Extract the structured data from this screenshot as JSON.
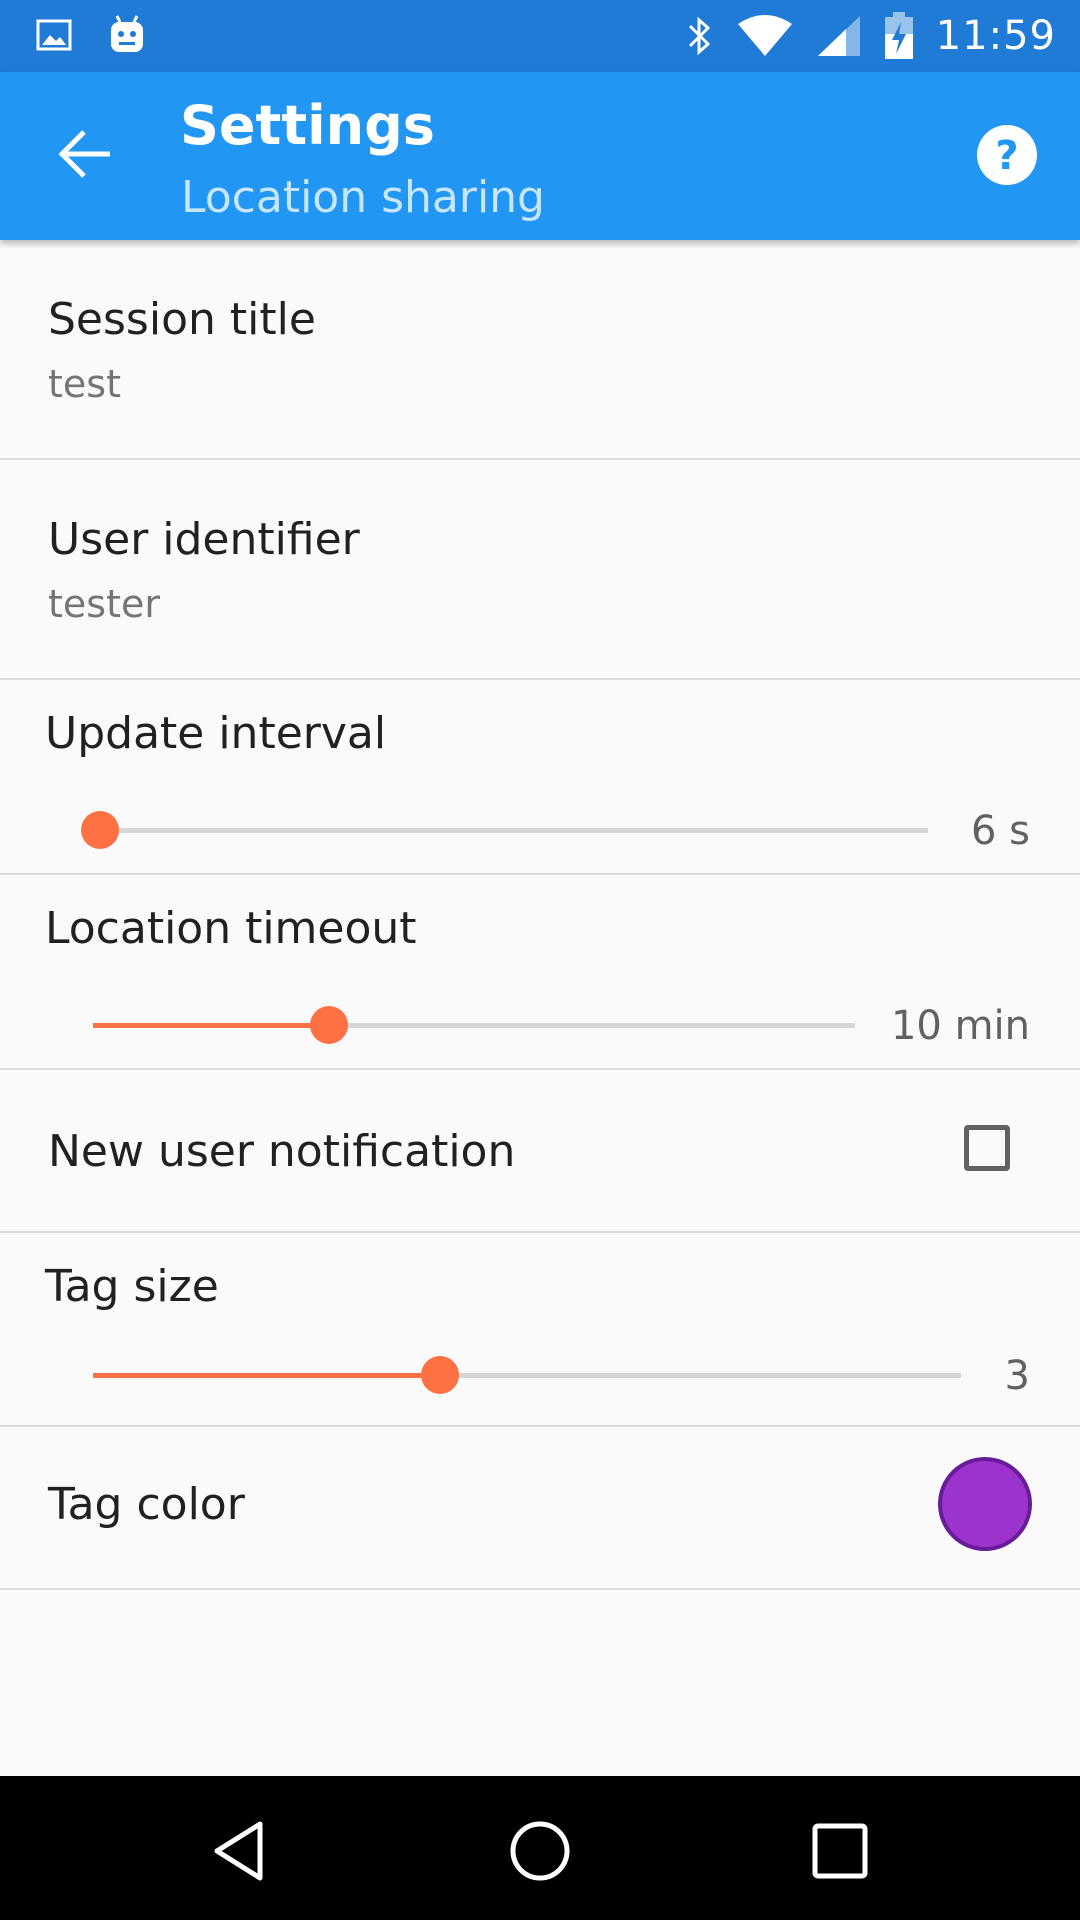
{
  "status_bar": {
    "icons_left": [
      "image-icon",
      "android-icon"
    ],
    "icons_right": [
      "bluetooth-icon",
      "wifi-icon",
      "signal-icon",
      "battery-charging-icon"
    ],
    "time": "11:59",
    "color": "#1f7bd6"
  },
  "app_bar": {
    "title": "Settings",
    "subtitle": "Location sharing",
    "back_icon": "arrow-back-icon",
    "help_icon": "help-icon",
    "color": "#2196f3"
  },
  "settings": {
    "session_title": {
      "label": "Session title",
      "value": "test"
    },
    "user_identifier": {
      "label": "User identifier",
      "value": "tester"
    },
    "update_interval": {
      "label": "Update interval",
      "value_text": "6 s",
      "fraction": 0.0
    },
    "location_timeout": {
      "label": "Location timeout",
      "value_text": "10 min",
      "fraction": 0.31
    },
    "new_user_notification": {
      "label": "New user notification",
      "checked": false
    },
    "tag_size": {
      "label": "Tag size",
      "value_text": "3",
      "fraction": 0.4
    },
    "tag_color": {
      "label": "Tag color",
      "color": "#9c33cc"
    }
  },
  "accent_color": "#ff7043",
  "nav_bar": {
    "buttons": [
      "back-triangle-icon",
      "home-circle-icon",
      "recents-square-icon"
    ]
  }
}
